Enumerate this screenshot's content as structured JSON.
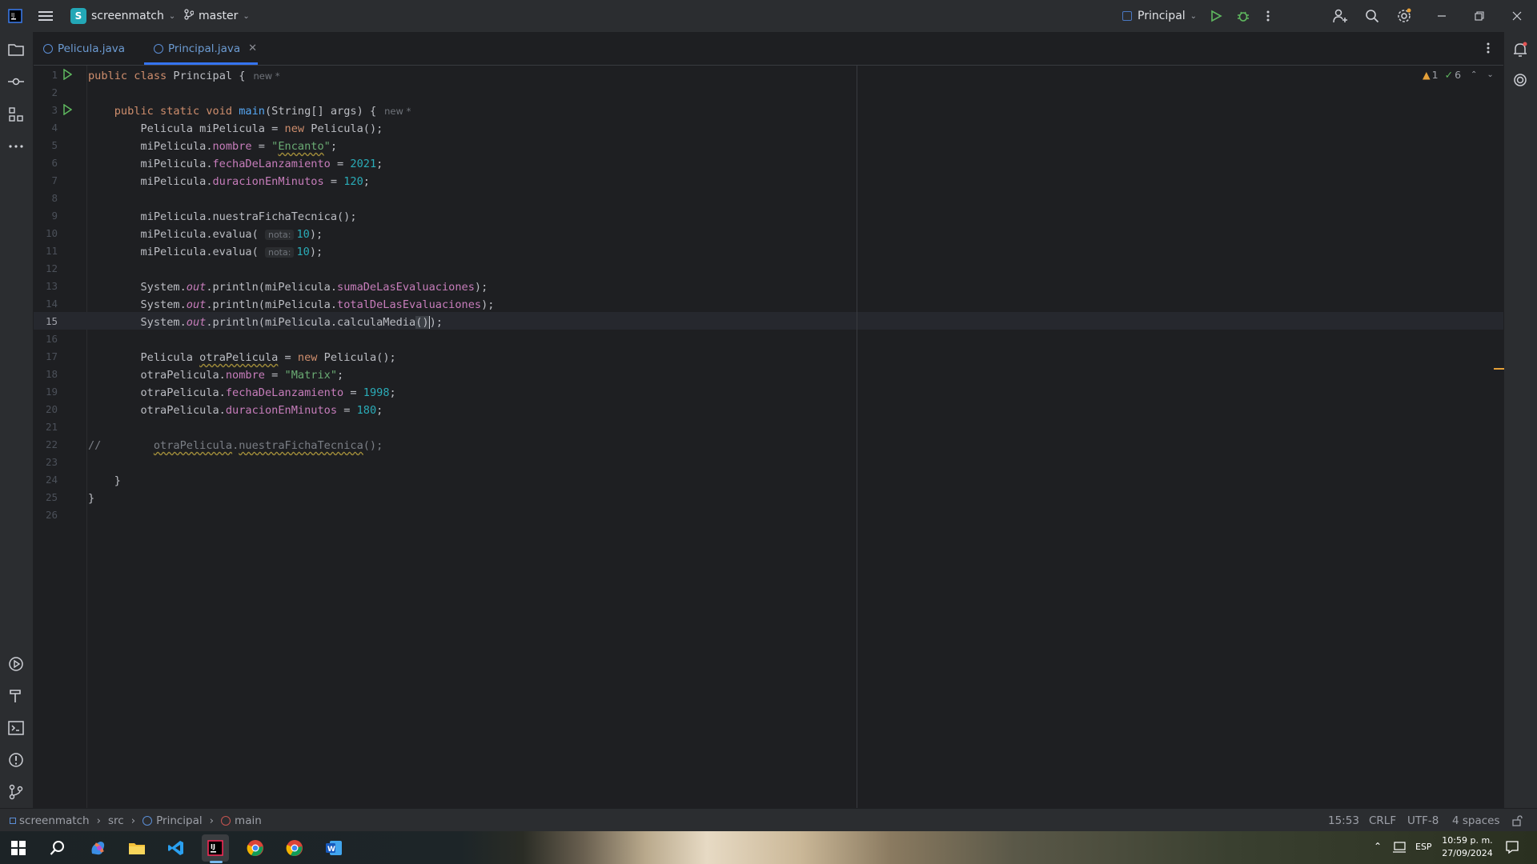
{
  "titlebar": {
    "project_initial": "S",
    "project_name": "screenmatch",
    "branch": "master",
    "run_config": "Principal"
  },
  "tabs": [
    {
      "label": "Pelicula.java",
      "active": false
    },
    {
      "label": "Principal.java",
      "active": true
    }
  ],
  "inspections": {
    "warnings": "1",
    "ok": "6"
  },
  "editor": {
    "hint_new": "new *",
    "param_hint": "nota:",
    "line_numbers": [
      "1",
      "2",
      "3",
      "4",
      "5",
      "6",
      "7",
      "8",
      "9",
      "10",
      "11",
      "12",
      "13",
      "14",
      "15",
      "16",
      "17",
      "18",
      "19",
      "20",
      "21",
      "22",
      "23",
      "24",
      "25",
      "26"
    ],
    "current_line": "15"
  },
  "statusbar": {
    "breadcrumb": [
      "screenmatch",
      "src",
      "Principal",
      "main"
    ],
    "position": "15:53",
    "line_sep": "CRLF",
    "encoding": "UTF-8",
    "indent": "4 spaces"
  },
  "taskbar": {
    "lang": "ESP",
    "time": "10:59 p. m.",
    "date": "27/09/2024"
  },
  "colors": {
    "background": "#1e1f22",
    "keyword": "#cf8e6d",
    "string": "#6aab73",
    "number": "#2aacb8",
    "field": "#c77dbb",
    "method": "#56a8f5"
  }
}
